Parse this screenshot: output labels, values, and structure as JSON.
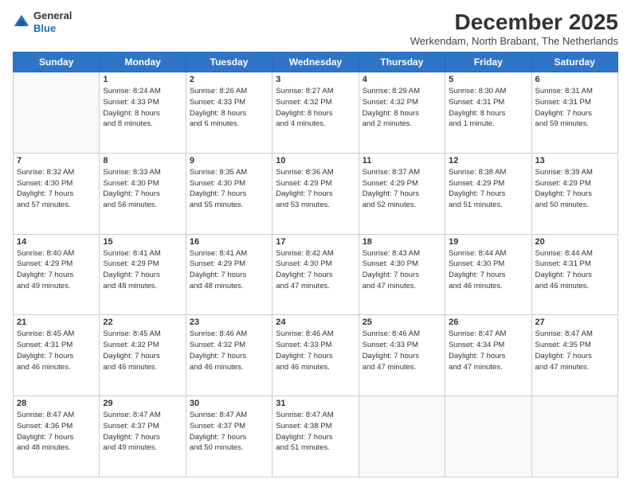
{
  "logo": {
    "general": "General",
    "blue": "Blue"
  },
  "title": "December 2025",
  "location": "Werkendam, North Brabant, The Netherlands",
  "headers": [
    "Sunday",
    "Monday",
    "Tuesday",
    "Wednesday",
    "Thursday",
    "Friday",
    "Saturday"
  ],
  "weeks": [
    [
      {
        "day": "",
        "info": ""
      },
      {
        "day": "1",
        "info": "Sunrise: 8:24 AM\nSunset: 4:33 PM\nDaylight: 8 hours\nand 8 minutes."
      },
      {
        "day": "2",
        "info": "Sunrise: 8:26 AM\nSunset: 4:33 PM\nDaylight: 8 hours\nand 6 minutes."
      },
      {
        "day": "3",
        "info": "Sunrise: 8:27 AM\nSunset: 4:32 PM\nDaylight: 8 hours\nand 4 minutes."
      },
      {
        "day": "4",
        "info": "Sunrise: 8:29 AM\nSunset: 4:32 PM\nDaylight: 8 hours\nand 2 minutes."
      },
      {
        "day": "5",
        "info": "Sunrise: 8:30 AM\nSunset: 4:31 PM\nDaylight: 8 hours\nand 1 minute."
      },
      {
        "day": "6",
        "info": "Sunrise: 8:31 AM\nSunset: 4:31 PM\nDaylight: 7 hours\nand 59 minutes."
      }
    ],
    [
      {
        "day": "7",
        "info": "Sunrise: 8:32 AM\nSunset: 4:30 PM\nDaylight: 7 hours\nand 57 minutes."
      },
      {
        "day": "8",
        "info": "Sunrise: 8:33 AM\nSunset: 4:30 PM\nDaylight: 7 hours\nand 56 minutes."
      },
      {
        "day": "9",
        "info": "Sunrise: 8:35 AM\nSunset: 4:30 PM\nDaylight: 7 hours\nand 55 minutes."
      },
      {
        "day": "10",
        "info": "Sunrise: 8:36 AM\nSunset: 4:29 PM\nDaylight: 7 hours\nand 53 minutes."
      },
      {
        "day": "11",
        "info": "Sunrise: 8:37 AM\nSunset: 4:29 PM\nDaylight: 7 hours\nand 52 minutes."
      },
      {
        "day": "12",
        "info": "Sunrise: 8:38 AM\nSunset: 4:29 PM\nDaylight: 7 hours\nand 51 minutes."
      },
      {
        "day": "13",
        "info": "Sunrise: 8:39 AM\nSunset: 4:29 PM\nDaylight: 7 hours\nand 50 minutes."
      }
    ],
    [
      {
        "day": "14",
        "info": "Sunrise: 8:40 AM\nSunset: 4:29 PM\nDaylight: 7 hours\nand 49 minutes."
      },
      {
        "day": "15",
        "info": "Sunrise: 8:41 AM\nSunset: 4:29 PM\nDaylight: 7 hours\nand 48 minutes."
      },
      {
        "day": "16",
        "info": "Sunrise: 8:41 AM\nSunset: 4:29 PM\nDaylight: 7 hours\nand 48 minutes."
      },
      {
        "day": "17",
        "info": "Sunrise: 8:42 AM\nSunset: 4:30 PM\nDaylight: 7 hours\nand 47 minutes."
      },
      {
        "day": "18",
        "info": "Sunrise: 8:43 AM\nSunset: 4:30 PM\nDaylight: 7 hours\nand 47 minutes."
      },
      {
        "day": "19",
        "info": "Sunrise: 8:44 AM\nSunset: 4:30 PM\nDaylight: 7 hours\nand 46 minutes."
      },
      {
        "day": "20",
        "info": "Sunrise: 8:44 AM\nSunset: 4:31 PM\nDaylight: 7 hours\nand 46 minutes."
      }
    ],
    [
      {
        "day": "21",
        "info": "Sunrise: 8:45 AM\nSunset: 4:31 PM\nDaylight: 7 hours\nand 46 minutes."
      },
      {
        "day": "22",
        "info": "Sunrise: 8:45 AM\nSunset: 4:32 PM\nDaylight: 7 hours\nand 46 minutes."
      },
      {
        "day": "23",
        "info": "Sunrise: 8:46 AM\nSunset: 4:32 PM\nDaylight: 7 hours\nand 46 minutes."
      },
      {
        "day": "24",
        "info": "Sunrise: 8:46 AM\nSunset: 4:33 PM\nDaylight: 7 hours\nand 46 minutes."
      },
      {
        "day": "25",
        "info": "Sunrise: 8:46 AM\nSunset: 4:33 PM\nDaylight: 7 hours\nand 47 minutes."
      },
      {
        "day": "26",
        "info": "Sunrise: 8:47 AM\nSunset: 4:34 PM\nDaylight: 7 hours\nand 47 minutes."
      },
      {
        "day": "27",
        "info": "Sunrise: 8:47 AM\nSunset: 4:35 PM\nDaylight: 7 hours\nand 47 minutes."
      }
    ],
    [
      {
        "day": "28",
        "info": "Sunrise: 8:47 AM\nSunset: 4:36 PM\nDaylight: 7 hours\nand 48 minutes."
      },
      {
        "day": "29",
        "info": "Sunrise: 8:47 AM\nSunset: 4:37 PM\nDaylight: 7 hours\nand 49 minutes."
      },
      {
        "day": "30",
        "info": "Sunrise: 8:47 AM\nSunset: 4:37 PM\nDaylight: 7 hours\nand 50 minutes."
      },
      {
        "day": "31",
        "info": "Sunrise: 8:47 AM\nSunset: 4:38 PM\nDaylight: 7 hours\nand 51 minutes."
      },
      {
        "day": "",
        "info": ""
      },
      {
        "day": "",
        "info": ""
      },
      {
        "day": "",
        "info": ""
      }
    ]
  ]
}
